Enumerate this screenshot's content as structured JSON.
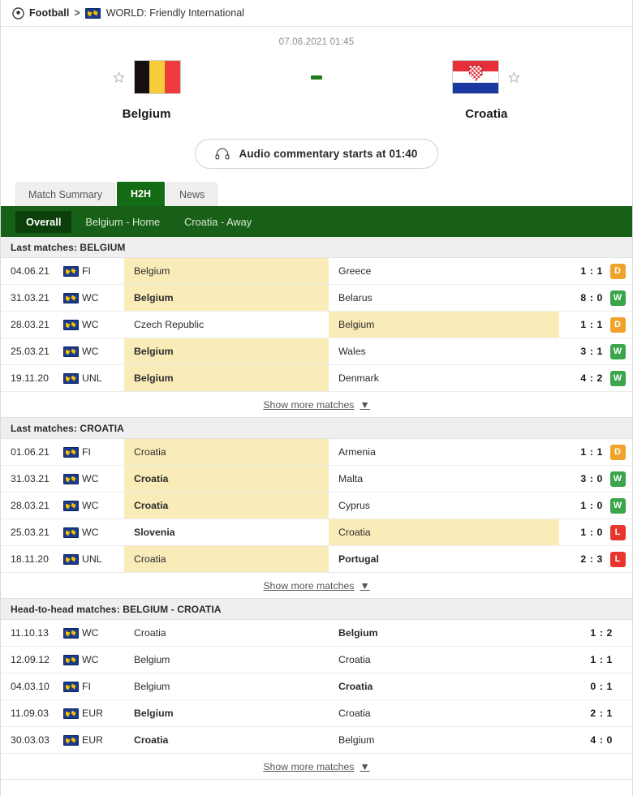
{
  "breadcrumb": {
    "sport": "Football",
    "separator": ">",
    "competition": "WORLD: Friendly International"
  },
  "match": {
    "kickoff": "07.06.2021 01:45",
    "home_team": "Belgium",
    "away_team": "Croatia",
    "score_placeholder": "-",
    "audio_label": "Audio commentary starts at 01:40"
  },
  "tabs": [
    {
      "label": "Match Summary",
      "active": false
    },
    {
      "label": "H2H",
      "active": true
    },
    {
      "label": "News",
      "active": false
    }
  ],
  "subtabs": [
    {
      "label": "Overall",
      "active": true
    },
    {
      "label": "Belgium - Home",
      "active": false
    },
    {
      "label": "Croatia - Away",
      "active": false
    }
  ],
  "show_more_label": "Show more matches",
  "sections": [
    {
      "title": "Last matches: BELGIUM",
      "has_badge": true,
      "rows": [
        {
          "date": "04.06.21",
          "comp": "FI",
          "home": "Belgium",
          "away": "Greece",
          "score": "1 : 1",
          "badge": "D",
          "home_hl": true,
          "away_hl": false,
          "home_win": false,
          "away_win": false
        },
        {
          "date": "31.03.21",
          "comp": "WC",
          "home": "Belgium",
          "away": "Belarus",
          "score": "8 : 0",
          "badge": "W",
          "home_hl": true,
          "away_hl": false,
          "home_win": true,
          "away_win": false
        },
        {
          "date": "28.03.21",
          "comp": "WC",
          "home": "Czech Republic",
          "away": "Belgium",
          "score": "1 : 1",
          "badge": "D",
          "home_hl": false,
          "away_hl": true,
          "home_win": false,
          "away_win": false
        },
        {
          "date": "25.03.21",
          "comp": "WC",
          "home": "Belgium",
          "away": "Wales",
          "score": "3 : 1",
          "badge": "W",
          "home_hl": true,
          "away_hl": false,
          "home_win": true,
          "away_win": false
        },
        {
          "date": "19.11.20",
          "comp": "UNL",
          "home": "Belgium",
          "away": "Denmark",
          "score": "4 : 2",
          "badge": "W",
          "home_hl": true,
          "away_hl": false,
          "home_win": true,
          "away_win": false
        }
      ]
    },
    {
      "title": "Last matches: CROATIA",
      "has_badge": true,
      "rows": [
        {
          "date": "01.06.21",
          "comp": "FI",
          "home": "Croatia",
          "away": "Armenia",
          "score": "1 : 1",
          "badge": "D",
          "home_hl": true,
          "away_hl": false,
          "home_win": false,
          "away_win": false
        },
        {
          "date": "31.03.21",
          "comp": "WC",
          "home": "Croatia",
          "away": "Malta",
          "score": "3 : 0",
          "badge": "W",
          "home_hl": true,
          "away_hl": false,
          "home_win": true,
          "away_win": false
        },
        {
          "date": "28.03.21",
          "comp": "WC",
          "home": "Croatia",
          "away": "Cyprus",
          "score": "1 : 0",
          "badge": "W",
          "home_hl": true,
          "away_hl": false,
          "home_win": true,
          "away_win": false
        },
        {
          "date": "25.03.21",
          "comp": "WC",
          "home": "Slovenia",
          "away": "Croatia",
          "score": "1 : 0",
          "badge": "L",
          "home_hl": false,
          "away_hl": true,
          "home_win": true,
          "away_win": false
        },
        {
          "date": "18.11.20",
          "comp": "UNL",
          "home": "Croatia",
          "away": "Portugal",
          "score": "2 : 3",
          "badge": "L",
          "home_hl": true,
          "away_hl": false,
          "home_win": false,
          "away_win": true
        }
      ]
    },
    {
      "title": "Head-to-head matches: BELGIUM - CROATIA",
      "has_badge": false,
      "rows": [
        {
          "date": "11.10.13",
          "comp": "WC",
          "home": "Croatia",
          "away": "Belgium",
          "score": "1 : 2",
          "badge": "",
          "home_hl": false,
          "away_hl": false,
          "home_win": false,
          "away_win": true
        },
        {
          "date": "12.09.12",
          "comp": "WC",
          "home": "Belgium",
          "away": "Croatia",
          "score": "1 : 1",
          "badge": "",
          "home_hl": false,
          "away_hl": false,
          "home_win": false,
          "away_win": false
        },
        {
          "date": "04.03.10",
          "comp": "FI",
          "home": "Belgium",
          "away": "Croatia",
          "score": "0 : 1",
          "badge": "",
          "home_hl": false,
          "away_hl": false,
          "home_win": false,
          "away_win": true
        },
        {
          "date": "11.09.03",
          "comp": "EUR",
          "home": "Belgium",
          "away": "Croatia",
          "score": "2 : 1",
          "badge": "",
          "home_hl": false,
          "away_hl": false,
          "home_win": true,
          "away_win": false
        },
        {
          "date": "30.03.03",
          "comp": "EUR",
          "home": "Croatia",
          "away": "Belgium",
          "score": "4 : 0",
          "badge": "",
          "home_hl": false,
          "away_hl": false,
          "home_win": true,
          "away_win": false
        }
      ]
    }
  ]
}
